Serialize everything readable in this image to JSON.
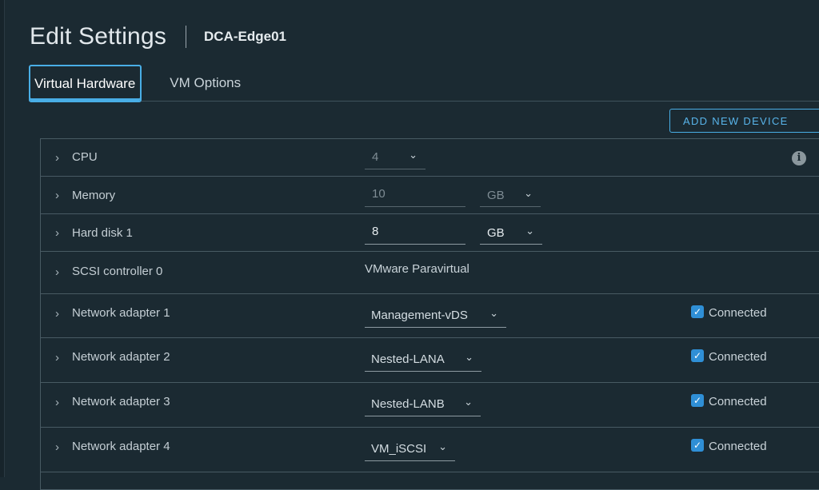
{
  "header": {
    "title": "Edit Settings",
    "vm_name": "DCA-Edge01"
  },
  "tabs": [
    {
      "label": "Virtual Hardware",
      "active": true
    },
    {
      "label": "VM Options",
      "active": false
    }
  ],
  "toolbar": {
    "add_device_label": "ADD NEW DEVICE"
  },
  "hardware": {
    "cpu": {
      "label": "CPU",
      "value": "4"
    },
    "memory": {
      "label": "Memory",
      "value": "10",
      "unit": "GB"
    },
    "hard_disk": {
      "label": "Hard disk 1",
      "value": "8",
      "unit": "GB"
    },
    "scsi": {
      "label": "SCSI controller 0",
      "value": "VMware Paravirtual"
    },
    "network_adapters": [
      {
        "label": "Network adapter 1",
        "network": "Management-vDS",
        "connected_label": "Connected",
        "connected": true
      },
      {
        "label": "Network adapter 2",
        "network": "Nested-LANA",
        "connected_label": "Connected",
        "connected": true
      },
      {
        "label": "Network adapter 3",
        "network": "Nested-LANB",
        "connected_label": "Connected",
        "connected": true
      },
      {
        "label": "Network adapter 4",
        "network": "VM_iSCSI",
        "connected_label": "Connected",
        "connected": true
      }
    ]
  },
  "icons": {
    "chevron": "›",
    "dropdown": "⌄",
    "check": "✓",
    "info": "i"
  },
  "colors": {
    "accent": "#49aee6",
    "background": "#1b2a32",
    "checkbox": "#2f8fd6"
  }
}
